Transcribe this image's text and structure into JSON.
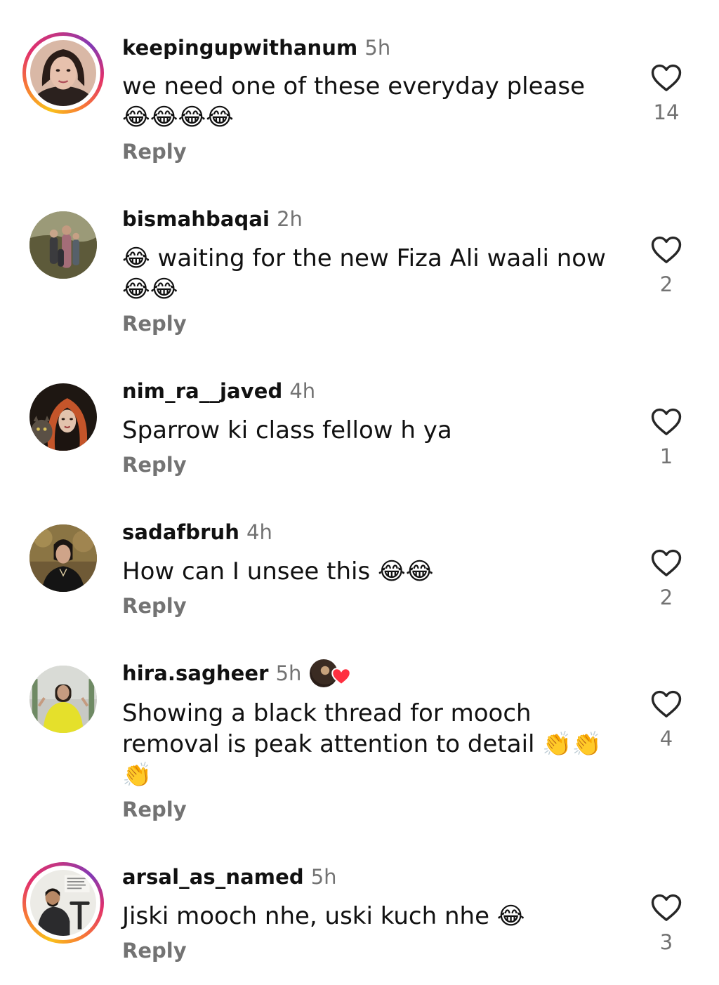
{
  "comments": [
    {
      "username": "keepingupwithanum",
      "time": "5h",
      "text": "we need one of these everyday please\n😂😂😂😂",
      "reply": "Reply",
      "likes": "14",
      "story_ring": true
    },
    {
      "username": "bismahbaqai",
      "time": "2h",
      "text": "😂 waiting for the new Fiza Ali waali now\n😂😂",
      "reply": "Reply",
      "likes": "2",
      "story_ring": false
    },
    {
      "username": "nim_ra__javed",
      "time": "4h",
      "text": "Sparrow ki class fellow h ya",
      "reply": "Reply",
      "likes": "1",
      "story_ring": false
    },
    {
      "username": "sadafbruh",
      "time": "4h",
      "text": "How can I unsee this 😂😂",
      "reply": "Reply",
      "likes": "2",
      "story_ring": false
    },
    {
      "username": "hira.sagheer",
      "time": "5h",
      "text": "Showing a black thread for mooch\nremoval is peak attention to detail 👏👏\n👏",
      "reply": "Reply",
      "likes": "4",
      "story_ring": false,
      "liked_by_creator": true
    },
    {
      "username": "arsal_as_named",
      "time": "5h",
      "text": "Jiski mooch nhe, uski kuch nhe 😂",
      "reply": "Reply",
      "likes": "3",
      "story_ring": true
    }
  ],
  "icons": {
    "like": "heart-outline-icon",
    "creator_like": "heart-filled-icon"
  },
  "colors": {
    "text": "#111111",
    "secondary": "#737373",
    "heart_red": "#ff3040"
  }
}
